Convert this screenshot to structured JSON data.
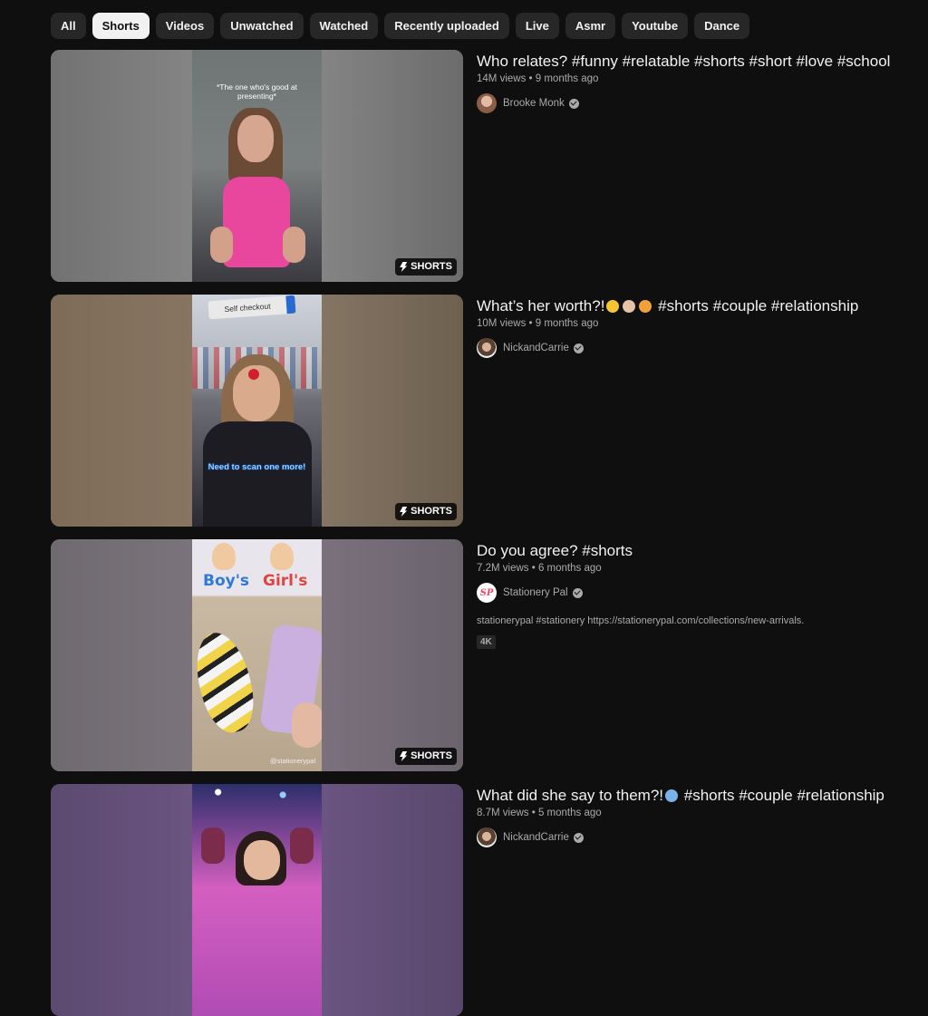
{
  "filters": [
    "All",
    "Shorts",
    "Videos",
    "Unwatched",
    "Watched",
    "Recently uploaded",
    "Live",
    "Asmr",
    "Youtube",
    "Dance"
  ],
  "active_filter": "Shorts",
  "shorts_badge": "SHORTS",
  "videos": [
    {
      "title": "Who relates? #funny #relatable #shorts #short #love #school",
      "views": "14M views",
      "age": "9 months ago",
      "channel": "Brooke Monk",
      "overlay_text": "*The one who's good at presenting*"
    },
    {
      "title_pre": "What’s her worth?!",
      "title_post": "#shorts #couple #relationship",
      "views": "10M views",
      "age": "9 months ago",
      "channel": "NickandCarrie",
      "overlay_top": "Self checkout",
      "overlay_caption": "Need to scan one more!"
    },
    {
      "title": "Do you agree? #shorts",
      "views": "7.2M views",
      "age": "6 months ago",
      "channel": "Stationery Pal",
      "avatar_text": "SP",
      "description": "stationerypal #stationery https://stationerypal.com/collections/new-arrivals.",
      "quality_badge": "4K",
      "overlay_left": "Boy's",
      "overlay_right": "Girl's",
      "watermark": "@stationerypal"
    },
    {
      "title_pre": "What did she say to them?!",
      "title_post": "#shorts #couple #relationship",
      "views": "8.7M views",
      "age": "5 months ago",
      "channel": "NickandCarrie"
    }
  ],
  "colors": {
    "background": "#0f0f0f",
    "chip": "#272727",
    "chip_active": "#f1f1f1",
    "text_secondary": "#aaaaaa"
  }
}
